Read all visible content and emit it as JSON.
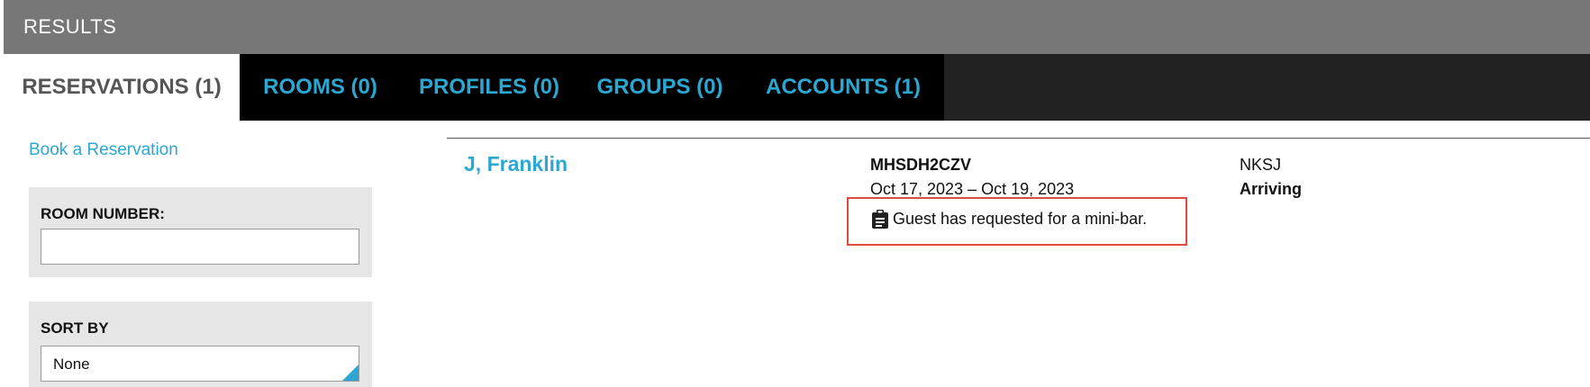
{
  "header": {
    "title": "RESULTS"
  },
  "tabs": [
    {
      "label": "RESERVATIONS (1)",
      "active": true
    },
    {
      "label": "ROOMS (0)",
      "active": false
    },
    {
      "label": "PROFILES (0)",
      "active": false
    },
    {
      "label": "GROUPS (0)",
      "active": false
    },
    {
      "label": "ACCOUNTS (1)",
      "active": false
    }
  ],
  "sidebar": {
    "book_link": "Book a Reservation",
    "room_number": {
      "label": "ROOM NUMBER:",
      "value": "",
      "placeholder": ""
    },
    "sort_by": {
      "label": "SORT BY",
      "selected": "None"
    }
  },
  "result": {
    "guest_name": "J, Franklin",
    "confirmation": "MHSDH2CZV",
    "dates": "Oct 17, 2023 – Oct 19, 2023",
    "note": "Guest has requested for a mini-bar.",
    "code": "NKSJ",
    "status": "Arriving"
  },
  "colors": {
    "accent": "#2ba7d1",
    "highlight_border": "#e04a3f",
    "header_bg": "#777777",
    "tabs_bg": "#000000"
  },
  "icons": {
    "note": "clipboard-icon"
  }
}
